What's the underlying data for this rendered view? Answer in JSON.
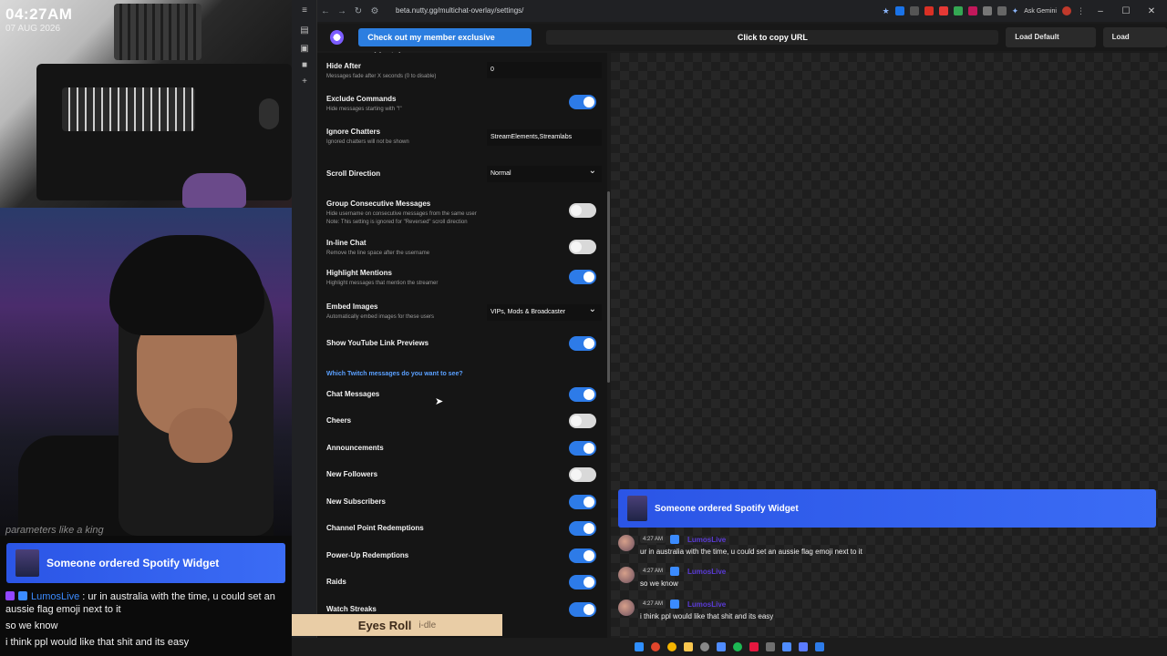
{
  "overlay": {
    "clock_time": "04:27AM",
    "clock_date": "07 AUG 2026",
    "ticker": "parameters like a king",
    "banner_text": "Someone ordered Spotify Widget",
    "chat": {
      "user": "LumosLive",
      "sep": " : ",
      "msg1": "ur in australia with the time, u could set an aussie flag emoji next to it",
      "msg2": "so we know",
      "msg3": "i think ppl would like that shit and its easy"
    },
    "now_playing": {
      "title": "Eyes Roll",
      "artist": "i-dle"
    }
  },
  "browser": {
    "url": "beta.nutty.gg/multichat-overlay/settings/",
    "ask_gemini": "Ask Gemini",
    "member_button": "Check out my member exclusive widgets!",
    "copy_url": "Click to copy URL",
    "load_default": "Load Default Settings",
    "load_settings": "Load Settings"
  },
  "settings": {
    "hide_after": {
      "label": "Hide After",
      "desc": "Messages fade after X seconds (0 to disable)",
      "value": "0"
    },
    "exclude_commands": {
      "label": "Exclude Commands",
      "desc": "Hide messages starting with \"!\"",
      "on": true
    },
    "ignore_chatters": {
      "label": "Ignore Chatters",
      "desc": "Ignored chatters will not be shown",
      "value": "StreamElements,Streamlabs"
    },
    "scroll_direction": {
      "label": "Scroll Direction",
      "value": "Normal"
    },
    "group_consecutive": {
      "label": "Group Consecutive Messages",
      "desc1": "Hide username on consecutive messages from the same user",
      "desc2": "Note: This setting is ignored for \"Reversed\" scroll direction",
      "on": false
    },
    "inline_chat": {
      "label": "In-line Chat",
      "desc": "Remove the line space after the username",
      "on": false
    },
    "highlight_mentions": {
      "label": "Highlight Mentions",
      "desc": "Highlight messages that mention the streamer",
      "on": true
    },
    "embed_images": {
      "label": "Embed Images",
      "desc": "Automatically embed images for these users",
      "value": "VIPs, Mods & Broadcaster"
    },
    "youtube_previews": {
      "label": "Show YouTube Link Previews",
      "on": true
    },
    "twitch_question": "Which Twitch messages do you want to see?",
    "twitch": [
      {
        "label": "Chat Messages",
        "on": true
      },
      {
        "label": "Cheers",
        "on": false
      },
      {
        "label": "Announcements",
        "on": true
      },
      {
        "label": "New Followers",
        "on": false
      },
      {
        "label": "New Subscribers",
        "on": true
      },
      {
        "label": "Channel Point Redemptions",
        "on": true
      },
      {
        "label": "Power-Up Redemptions",
        "on": true
      },
      {
        "label": "Raids",
        "on": true
      },
      {
        "label": "Watch Streaks",
        "on": true
      }
    ]
  },
  "preview": {
    "banner_text": "Someone ordered Spotify Widget",
    "messages": [
      {
        "time": "4:27 AM",
        "user": "LumosLive",
        "text": "ur in australia with the time, u could set an aussie flag emoji next to it"
      },
      {
        "time": "4:27 AM",
        "user": "LumosLive",
        "text": "so we know"
      },
      {
        "time": "4:27 AM",
        "user": "LumosLive",
        "text": "i think ppl would like that shit and its easy"
      }
    ]
  },
  "colors": {
    "accent": "#2d7be8",
    "banner": "#3b6cf5",
    "username": "#3b8bff"
  }
}
